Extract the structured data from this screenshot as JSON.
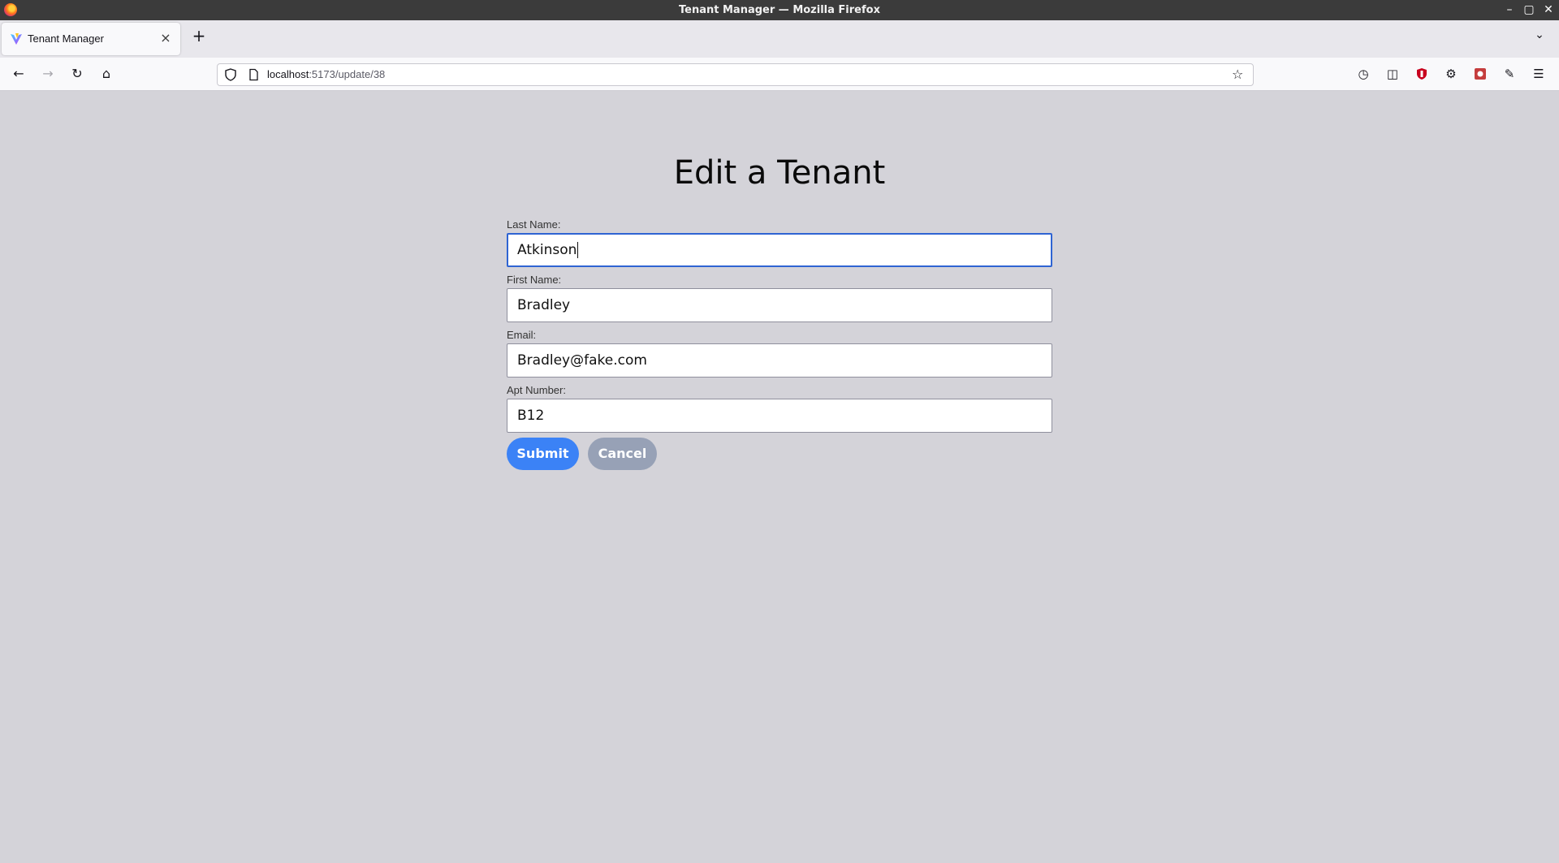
{
  "window": {
    "title": "Tenant Manager — Mozilla Firefox"
  },
  "tab": {
    "label": "Tenant Manager"
  },
  "urlbar": {
    "host": "localhost",
    "path": ":5173/update/38"
  },
  "page": {
    "title": "Edit a Tenant"
  },
  "form": {
    "fields": [
      {
        "label": "Last Name:",
        "value": "Atkinson"
      },
      {
        "label": "First Name:",
        "value": "Bradley"
      },
      {
        "label": "Email:",
        "value": "Bradley@fake.com"
      },
      {
        "label": "Apt Number:",
        "value": "B12"
      }
    ],
    "submit_label": "Submit",
    "cancel_label": "Cancel"
  },
  "colors": {
    "accent": "#3b82f6",
    "cancel": "#97a1b6",
    "focus": "#2f64d3",
    "page_bg": "#d4d3d9"
  }
}
